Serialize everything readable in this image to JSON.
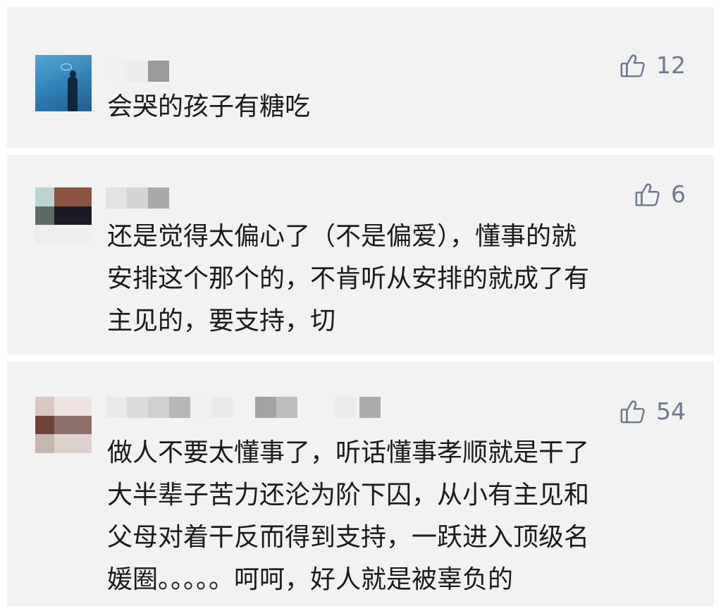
{
  "comments": [
    {
      "avatar_icon": "user-avatar-photo",
      "name_blurred": true,
      "likes": "12",
      "text": "会哭的孩子有糖吃",
      "like_icon": "thumbs-up-icon"
    },
    {
      "avatar_icon": "user-avatar-mosaic",
      "name_blurred": true,
      "likes": "6",
      "text": "还是觉得太偏心了（不是偏爱），懂事的就\n安排这个那个的，不肯听从安排的就成了有\n主见的，要支持，切",
      "like_icon": "thumbs-up-icon"
    },
    {
      "avatar_icon": "user-avatar-mosaic",
      "name_blurred": true,
      "likes": "54",
      "text": "做人不要太懂事了，听话懂事孝顺就是干了\n大半辈子苦力还沦为阶下囚，从小有主见和\n父母对着干反而得到支持，一跃进入顶级名\n媛圈。。。。。呵呵，好人就是被辜负的",
      "like_icon": "thumbs-up-icon"
    }
  ],
  "colors": {
    "card_background": "#f2f2f2",
    "page_background": "#ffffff",
    "like_color": "#6e7a8e",
    "text_color": "#1b1b1b"
  }
}
